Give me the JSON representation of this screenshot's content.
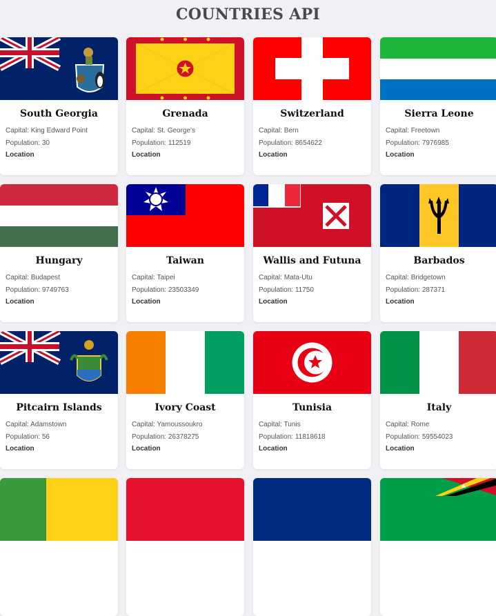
{
  "header": {
    "title": "COUNTRIES API"
  },
  "labels": {
    "capital": "Capital: ",
    "population": "Population: ",
    "location": "Location"
  },
  "countries": [
    {
      "name": "South Georgia",
      "capital": "King Edward Point",
      "population": "30",
      "flag": "south-georgia-flag"
    },
    {
      "name": "Grenada",
      "capital": "St. George's",
      "population": "112519",
      "flag": "grenada-flag"
    },
    {
      "name": "Switzerland",
      "capital": "Bern",
      "population": "8654622",
      "flag": "switzerland-flag"
    },
    {
      "name": "Sierra Leone",
      "capital": "Freetown",
      "population": "7976985",
      "flag": "sierra-leone-flag"
    },
    {
      "name": "Hungary",
      "capital": "Budapest",
      "population": "9749763",
      "flag": "hungary-flag"
    },
    {
      "name": "Taiwan",
      "capital": "Taipei",
      "population": "23503349",
      "flag": "taiwan-flag"
    },
    {
      "name": "Wallis and Futuna",
      "capital": "Mata-Utu",
      "population": "11750",
      "flag": "wallis-futuna-flag"
    },
    {
      "name": "Barbados",
      "capital": "Bridgetown",
      "population": "287371",
      "flag": "barbados-flag"
    },
    {
      "name": "Pitcairn Islands",
      "capital": "Adamstown",
      "population": "56",
      "flag": "pitcairn-flag"
    },
    {
      "name": "Ivory Coast",
      "capital": "Yamoussoukro",
      "population": "26378275",
      "flag": "ivory-coast-flag"
    },
    {
      "name": "Tunisia",
      "capital": "Tunis",
      "population": "11818618",
      "flag": "tunisia-flag"
    },
    {
      "name": "Italy",
      "capital": "Rome",
      "population": "59554023",
      "flag": "italy-flag"
    }
  ],
  "colors": {
    "background": "#f1f1f5",
    "card": "#ffffff",
    "title": "#4a4a4a"
  }
}
